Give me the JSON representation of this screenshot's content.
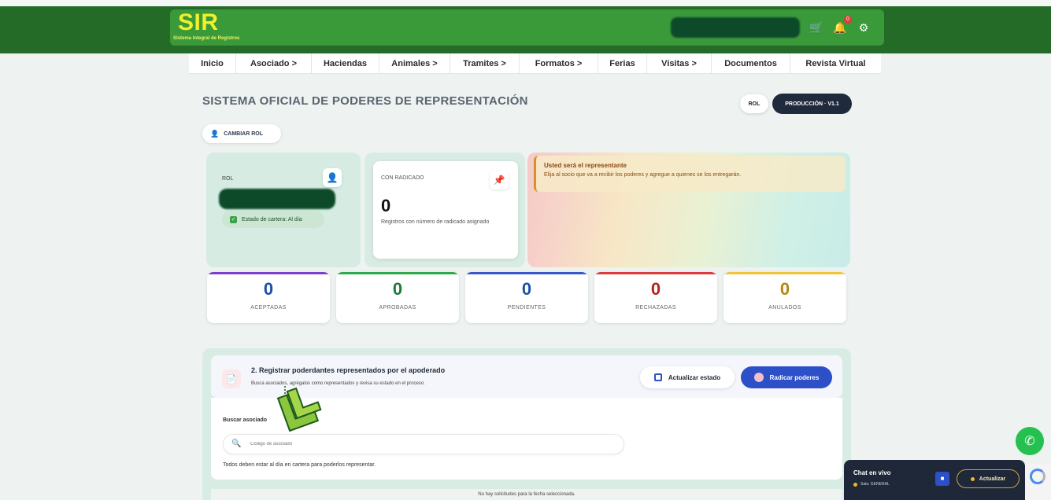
{
  "header": {
    "logo": "SIR",
    "logo_subtitle": "Sistema Integral de Registros",
    "notification_count": "0"
  },
  "nav": {
    "items": [
      {
        "label": "Inicio"
      },
      {
        "label": "Asociado >"
      },
      {
        "label": "Haciendas"
      },
      {
        "label": "Animales >"
      },
      {
        "label": "Tramites >"
      },
      {
        "label": "Formatos >"
      },
      {
        "label": "Ferias"
      },
      {
        "label": "Visitas >"
      },
      {
        "label": "Documentos"
      },
      {
        "label": "Revista Virtual"
      }
    ]
  },
  "page": {
    "title": "SISTEMA OFICIAL DE PODERES DE REPRESENTACIÓN",
    "rol_pill": "ROL",
    "env_pill": "PRODUCCIÓN · V1.1",
    "cambiar_rol": "CAMBIAR ROL"
  },
  "rol_card": {
    "label": "ROL",
    "estado": "Estado de cartera: Al día"
  },
  "radicado_card": {
    "label": "CON RADICADO",
    "value": "0",
    "description": "Registros con número de radicado asignado"
  },
  "alert": {
    "title": "Usted será el representante",
    "text": "Elija al socio que va a recibir los poderes y agregue a quienes se los entregarán."
  },
  "stats": [
    {
      "value": "0",
      "label": "ACEPTADAS",
      "color": "#1c4fa8",
      "bar": "#7b3fd0"
    },
    {
      "value": "0",
      "label": "APROBADAS",
      "color": "#1c7a3a",
      "bar": "#2ea84a"
    },
    {
      "value": "0",
      "label": "PENDIENTES",
      "color": "#1c4fa8",
      "bar": "#3a56c8"
    },
    {
      "value": "0",
      "label": "RECHAZADAS",
      "color": "#b32222",
      "bar": "#d93a3a"
    },
    {
      "value": "0",
      "label": "ANULADOS",
      "color": "#b5860f",
      "bar": "#f0c53a"
    }
  ],
  "section": {
    "title": "2. Registrar poderdantes representados por el apoderado",
    "subtitle": "Busca asociados, agrégalos como representados y revisa su estado en el proceso.",
    "btn_update": "Actualizar estado",
    "btn_radicar": "Radicar poderes",
    "search_label": "Buscar asociado",
    "search_placeholder": "Código de asociado",
    "note": "Todos deben estar al día en cartera para poderlos representar.",
    "empty": "No hay solicitudes para la fecha seleccionada."
  },
  "chat": {
    "title": "Chat en vivo",
    "status": "Sala: GENERAL",
    "update_btn": "Actualizar"
  }
}
